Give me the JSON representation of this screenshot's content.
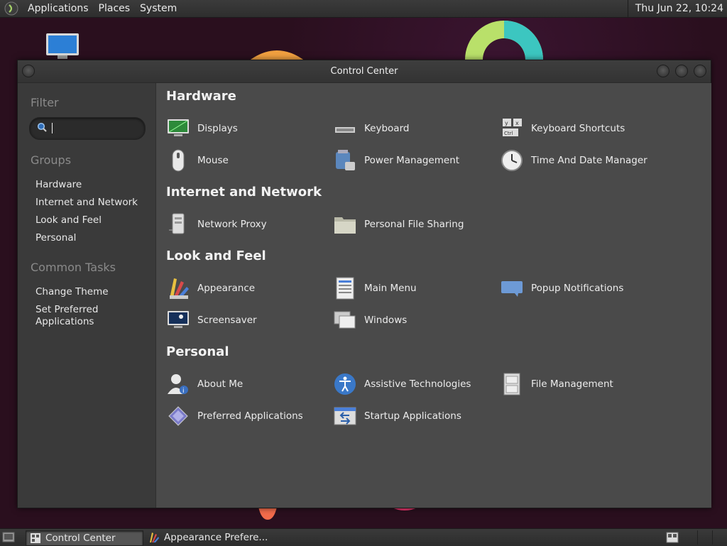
{
  "top_panel": {
    "menus": [
      "Applications",
      "Places",
      "System"
    ],
    "clock": "Thu Jun 22, 10:24"
  },
  "window": {
    "title": "Control Center"
  },
  "sidebar": {
    "filter_heading": "Filter",
    "search_value": "",
    "groups_heading": "Groups",
    "groups": [
      "Hardware",
      "Internet and Network",
      "Look and Feel",
      "Personal"
    ],
    "tasks_heading": "Common Tasks",
    "tasks": [
      "Change Theme",
      "Set Preferred\nApplications"
    ]
  },
  "main": {
    "groups": [
      {
        "title": "Hardware",
        "items": [
          {
            "label": "Displays",
            "icon": "display-icon"
          },
          {
            "label": "Keyboard",
            "icon": "keyboard-icon"
          },
          {
            "label": "Keyboard Shortcuts",
            "icon": "keyboard-shortcuts-icon"
          },
          {
            "label": "Mouse",
            "icon": "mouse-icon"
          },
          {
            "label": "Power Management",
            "icon": "power-management-icon"
          },
          {
            "label": "Time And Date Manager",
            "icon": "clock-icon"
          }
        ]
      },
      {
        "title": "Internet and Network",
        "items": [
          {
            "label": "Network Proxy",
            "icon": "network-proxy-icon"
          },
          {
            "label": "Personal File Sharing",
            "icon": "folder-share-icon"
          }
        ]
      },
      {
        "title": "Look and Feel",
        "items": [
          {
            "label": "Appearance",
            "icon": "appearance-icon"
          },
          {
            "label": "Main Menu",
            "icon": "main-menu-icon"
          },
          {
            "label": "Popup Notifications",
            "icon": "notification-icon"
          },
          {
            "label": "Screensaver",
            "icon": "screensaver-icon"
          },
          {
            "label": "Windows",
            "icon": "windows-icon"
          }
        ]
      },
      {
        "title": "Personal",
        "items": [
          {
            "label": "About Me",
            "icon": "about-me-icon"
          },
          {
            "label": "Assistive Technologies",
            "icon": "accessibility-icon"
          },
          {
            "label": "File Management",
            "icon": "file-cabinet-icon"
          },
          {
            "label": "Preferred Applications",
            "icon": "preferred-apps-icon"
          },
          {
            "label": "Startup Applications",
            "icon": "startup-apps-icon"
          }
        ]
      }
    ]
  },
  "taskbar": {
    "tasks": [
      {
        "label": "Control Center",
        "active": true
      },
      {
        "label": "Appearance Prefere...",
        "active": false
      }
    ]
  }
}
